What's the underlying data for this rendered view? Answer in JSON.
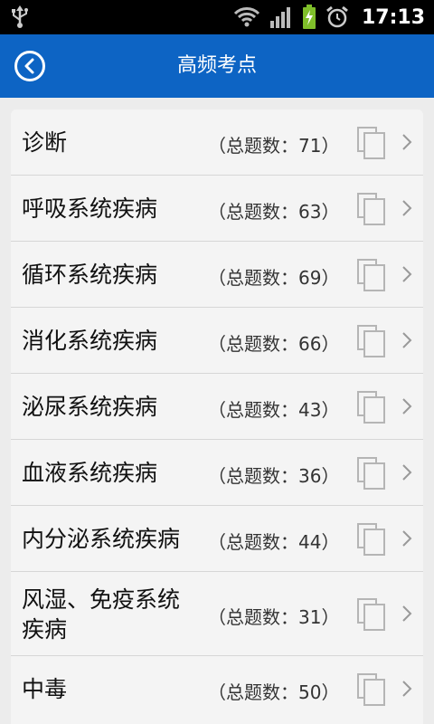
{
  "status_bar": {
    "time": "17:13"
  },
  "header": {
    "title": "高频考点"
  },
  "list": {
    "items": [
      {
        "name": "诊断",
        "count_prefix": "（总题数：",
        "count": "71",
        "count_suffix": "）"
      },
      {
        "name": "呼吸系统疾病",
        "count_prefix": "（总题数：",
        "count": "63",
        "count_suffix": "）"
      },
      {
        "name": "循环系统疾病",
        "count_prefix": "（总题数：",
        "count": "69",
        "count_suffix": "）"
      },
      {
        "name": "消化系统疾病",
        "count_prefix": "（总题数：",
        "count": "66",
        "count_suffix": "）"
      },
      {
        "name": "泌尿系统疾病",
        "count_prefix": "（总题数：",
        "count": "43",
        "count_suffix": "）"
      },
      {
        "name": "血液系统疾病",
        "count_prefix": "（总题数：",
        "count": "36",
        "count_suffix": "）"
      },
      {
        "name": "内分泌系统疾病",
        "count_prefix": "（总题数：",
        "count": "44",
        "count_suffix": "）"
      },
      {
        "name": "风湿、免疫系统疾病",
        "name_line1": "风湿、免疫系统",
        "name_line2": "疾病",
        "count_prefix": "（总题数：",
        "count": "31",
        "count_suffix": "）"
      },
      {
        "name": "中毒",
        "count_prefix": "（总题数：",
        "count": "50",
        "count_suffix": "）"
      }
    ]
  },
  "colors": {
    "appbar": "#0d64c4",
    "background": "#ececec",
    "status_bar": "#000000"
  }
}
